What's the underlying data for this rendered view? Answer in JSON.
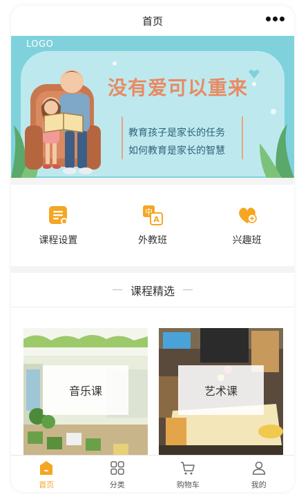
{
  "navbar": {
    "title": "首页",
    "more_icon": "more-dots-icon"
  },
  "banner": {
    "logo_text": "LOGO",
    "headline": "没有爱可以重来",
    "line1": "教育孩子是家长的任务",
    "line2": "如何教育是家长的智慧",
    "colors": {
      "sky": "#7fd2dc",
      "headline": "#e98a63",
      "text": "#2f5f78"
    }
  },
  "menu": {
    "items": [
      {
        "label": "课程设置",
        "icon": "course-settings-icon"
      },
      {
        "label": "外教班",
        "icon": "translate-icon"
      },
      {
        "label": "兴趣班",
        "icon": "heart-icon"
      }
    ],
    "accent": "#f5a623"
  },
  "section": {
    "title": "课程精选",
    "courses": [
      {
        "label": "音乐课"
      },
      {
        "label": "艺术课"
      }
    ]
  },
  "tabbar": {
    "tabs": [
      {
        "label": "首页",
        "icon": "home-icon",
        "active": true
      },
      {
        "label": "分类",
        "icon": "grid-icon",
        "active": false
      },
      {
        "label": "购物车",
        "icon": "cart-icon",
        "active": false
      },
      {
        "label": "我的",
        "icon": "user-icon",
        "active": false
      }
    ]
  }
}
